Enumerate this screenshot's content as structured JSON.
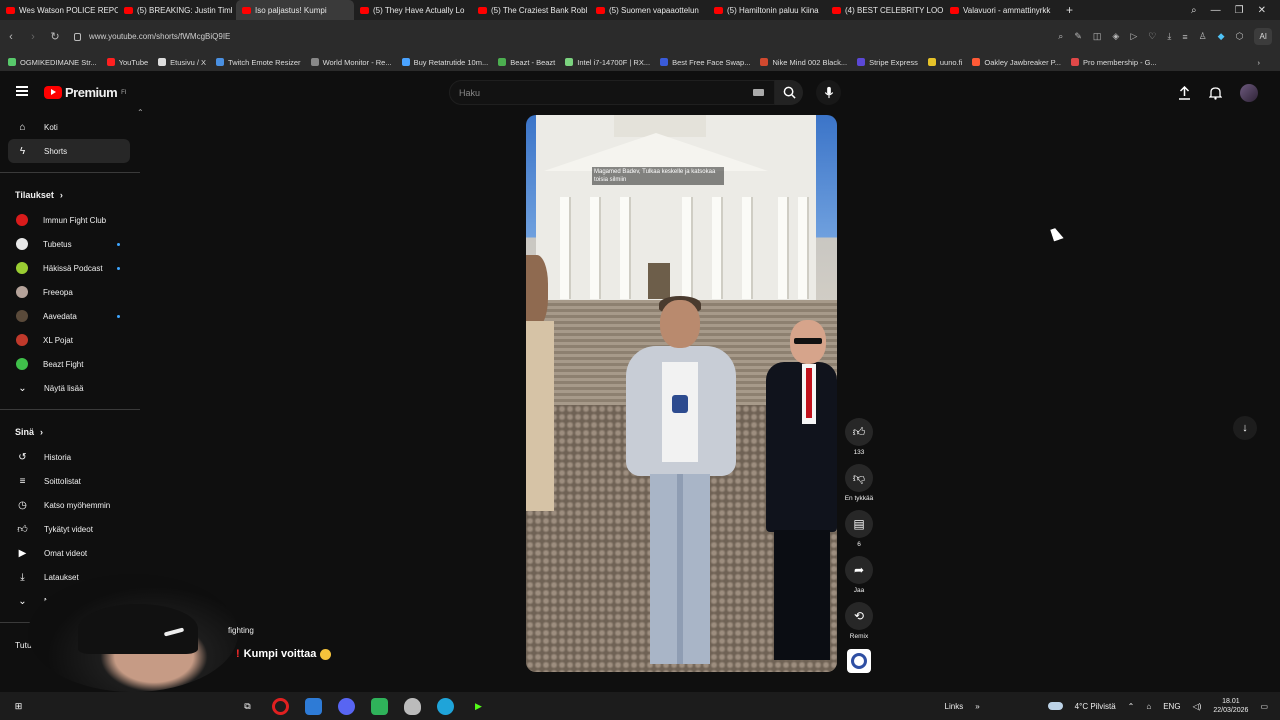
{
  "browser": {
    "tabs": [
      {
        "title": "Wes Watson POLICE REPO",
        "icon": "youtube",
        "active": false
      },
      {
        "title": "(5) BREAKING: Justin Timl",
        "icon": "youtube",
        "active": false
      },
      {
        "title": "Iso paljastus! Kumpi",
        "icon": "youtube",
        "active": true
      },
      {
        "title": "(5) They Have Actually Lo",
        "icon": "youtube",
        "active": false
      },
      {
        "title": "(5) The Craziest Bank Robl",
        "icon": "youtube",
        "active": false
      },
      {
        "title": "(5) Suomen vapaaottelun",
        "icon": "youtube",
        "active": false
      },
      {
        "title": "(5) Hamiltonin paluu Kiina",
        "icon": "youtube",
        "active": false
      },
      {
        "title": "(4) BEST CELEBRITY LOOK",
        "icon": "youtube",
        "active": false
      },
      {
        "title": "Valavuori - ammattinyrkk",
        "icon": "youtube",
        "active": false
      }
    ],
    "url": "www.youtube.com/shorts/fWMcgBiQ9IE",
    "ai_label": "AI",
    "bookmarks": [
      "OGMIKEDIMANE Str...",
      "YouTube",
      "Etusivu / X",
      "Twitch Emote Resizer",
      "World Monitor - Re...",
      "Buy Retatrutide 10m...",
      "Beazt - Beazt",
      "Intel i7-14700F | RX...",
      "Best Free Face Swap...",
      "Nike Mind 002 Black...",
      "Stripe Express",
      "uuno.fi",
      "Oakley Jawbreaker P...",
      "Pro membership - G..."
    ]
  },
  "youtube": {
    "logo_text": "Premium",
    "logo_region": "FI",
    "search_placeholder": "Haku",
    "sidebar": {
      "main": [
        {
          "label": "Koti",
          "icon": "home-icon"
        },
        {
          "label": "Shorts",
          "icon": "shorts-icon",
          "selected": true
        }
      ],
      "subs_header": "Tilaukset",
      "subs": [
        {
          "label": "Immun Fight Club",
          "color": "#d91b1b",
          "dot": false
        },
        {
          "label": "Tubetus",
          "color": "#e8e8e8",
          "dot": true
        },
        {
          "label": "Häkissä Podcast",
          "color": "#9acd32",
          "dot": true
        },
        {
          "label": "Freeopa",
          "color": "#b5a39a",
          "dot": false
        },
        {
          "label": "Aavedata",
          "color": "#5a4a3a",
          "dot": true
        },
        {
          "label": "XL Pojat",
          "color": "#c0392b",
          "dot": false
        },
        {
          "label": "Beazt Fight",
          "color": "#3fbf4a",
          "dot": false
        }
      ],
      "show_more": "Näytä lisää",
      "you_header": "Sinä",
      "you": [
        {
          "label": "Historia",
          "icon": "history-icon"
        },
        {
          "label": "Soittolistat",
          "icon": "playlists-icon"
        },
        {
          "label": "Katso myöhemmin",
          "icon": "watch-later-icon"
        },
        {
          "label": "Tykätyt videot",
          "icon": "liked-videos-icon"
        },
        {
          "label": "Omat videot",
          "icon": "your-videos-icon"
        },
        {
          "label": "Lataukset",
          "icon": "downloads-icon"
        },
        {
          "label": "Näytä lisää",
          "icon": "chevron-down-icon"
        }
      ],
      "explore_header": "Tutustu"
    },
    "short": {
      "caption": "Magamed Badev, Tulkaa keskelle ja katsokaa toisia silmiin",
      "actions": [
        {
          "name": "like",
          "icon": "thumb-up-icon",
          "label": "133"
        },
        {
          "name": "dislike",
          "icon": "thumb-down-icon",
          "label": "En tykkää"
        },
        {
          "name": "comments",
          "icon": "comment-icon",
          "label": "6"
        },
        {
          "name": "share",
          "icon": "share-icon",
          "label": "Jaa"
        },
        {
          "name": "remix",
          "icon": "remix-icon",
          "label": "Remix"
        }
      ]
    }
  },
  "stream_overlay": {
    "tag": "fighting",
    "message": "Kumpi voittaa"
  },
  "taskbar": {
    "links_label": "Links",
    "weather": "4°C  Pilvistä",
    "lang": "ENG",
    "time": "18.01",
    "date": "22/03/2026"
  }
}
